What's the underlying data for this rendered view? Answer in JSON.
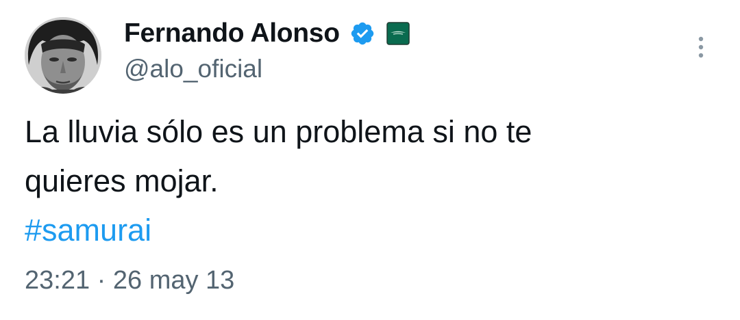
{
  "author": {
    "display_name": "Fernando Alonso",
    "handle": "@alo_oficial",
    "verified_icon": "verified-badge-icon",
    "affiliation_icon": "aston-martin-badge-icon",
    "avatar": "profile-photo"
  },
  "tweet": {
    "line1": "La lluvia sólo es un problema si no te",
    "line2": "quieres mojar.",
    "hashtag": "#samurai"
  },
  "meta": {
    "time": "23:21",
    "separator": "·",
    "date": "26 may 13"
  },
  "menu_icon": "more-vertical-icon",
  "colors": {
    "text": "#0f1419",
    "secondary": "#536471",
    "link": "#1d9bf0",
    "verified": "#1d9bf0",
    "affiliation": "#0a6b4f"
  }
}
